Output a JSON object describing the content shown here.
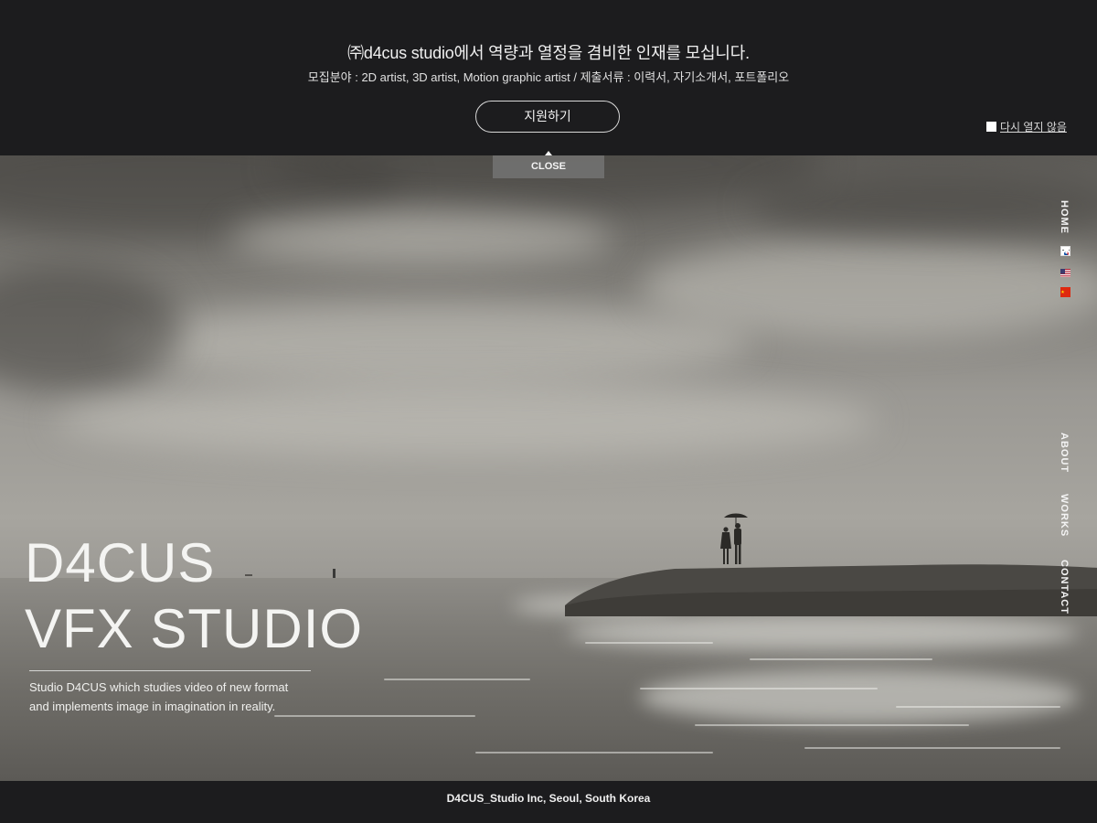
{
  "banner": {
    "title": "㈜d4cus studio에서 역량과 열정을 겸비한 인재를 모십니다.",
    "subtitle": "모집분야 : 2D artist, 3D artist, Motion graphic artist / 제출서류 : 이력서, 자기소개서, 포트폴리오",
    "apply_label": "지원하기",
    "hide_again_label": "다시 열지 않음"
  },
  "close_label": "CLOSE",
  "nav": {
    "home": "HOME",
    "about": "ABOUT",
    "works": "WORKS",
    "contact": "CONTACT",
    "languages": [
      "korean-flag-icon",
      "us-flag-icon",
      "china-flag-icon"
    ]
  },
  "hero": {
    "title_line1": "D4CUS",
    "title_line2": "VFX STUDIO",
    "description_line1": "Studio D4CUS which studies video of new format",
    "description_line2": "and implements image in imagination in reality."
  },
  "footer": {
    "text": "D4CUS_Studio Inc, Seoul, South Korea"
  },
  "colors": {
    "bar_background": "#1c1c1e",
    "text_light": "#f0f0f0",
    "close_tab": "#787878"
  }
}
